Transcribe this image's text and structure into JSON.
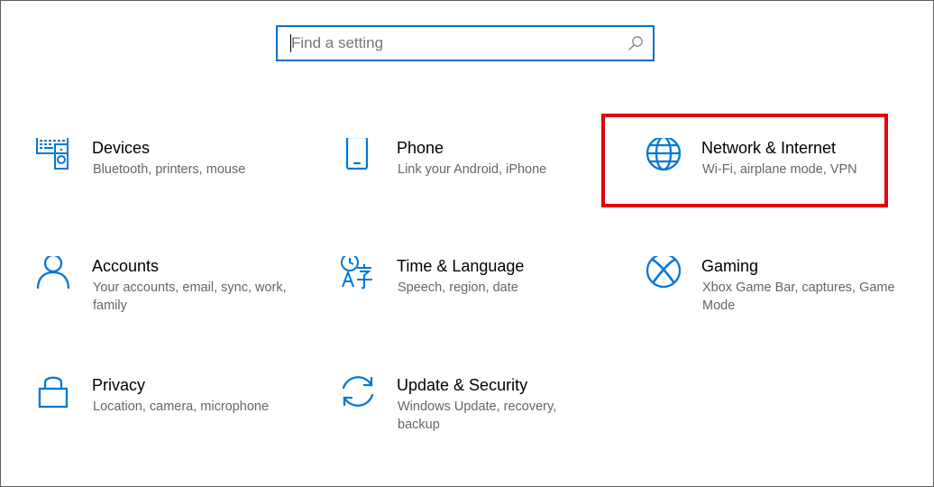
{
  "search": {
    "placeholder": "Find a setting",
    "value": ""
  },
  "colors": {
    "accent": "#0078d4",
    "highlight": "#e3000f",
    "desc_text": "#666666"
  },
  "categories": [
    {
      "id": "devices",
      "icon": "devices-icon",
      "title": "Devices",
      "description": "Bluetooth, printers, mouse"
    },
    {
      "id": "phone",
      "icon": "phone-icon",
      "title": "Phone",
      "description": "Link your Android, iPhone"
    },
    {
      "id": "network",
      "icon": "globe-icon",
      "title": "Network & Internet",
      "description": "Wi-Fi, airplane mode, VPN",
      "highlighted": true
    },
    {
      "id": "accounts",
      "icon": "person-icon",
      "title": "Accounts",
      "description": "Your accounts, email, sync, work, family"
    },
    {
      "id": "time-language",
      "icon": "time-language-icon",
      "title": "Time & Language",
      "description": "Speech, region, date"
    },
    {
      "id": "gaming",
      "icon": "xbox-icon",
      "title": "Gaming",
      "description": "Xbox Game Bar, captures, Game Mode"
    },
    {
      "id": "privacy",
      "icon": "lock-icon",
      "title": "Privacy",
      "description": "Location, camera, microphone"
    },
    {
      "id": "update-security",
      "icon": "sync-icon",
      "title": "Update & Security",
      "description": "Windows Update, recovery, backup"
    }
  ]
}
